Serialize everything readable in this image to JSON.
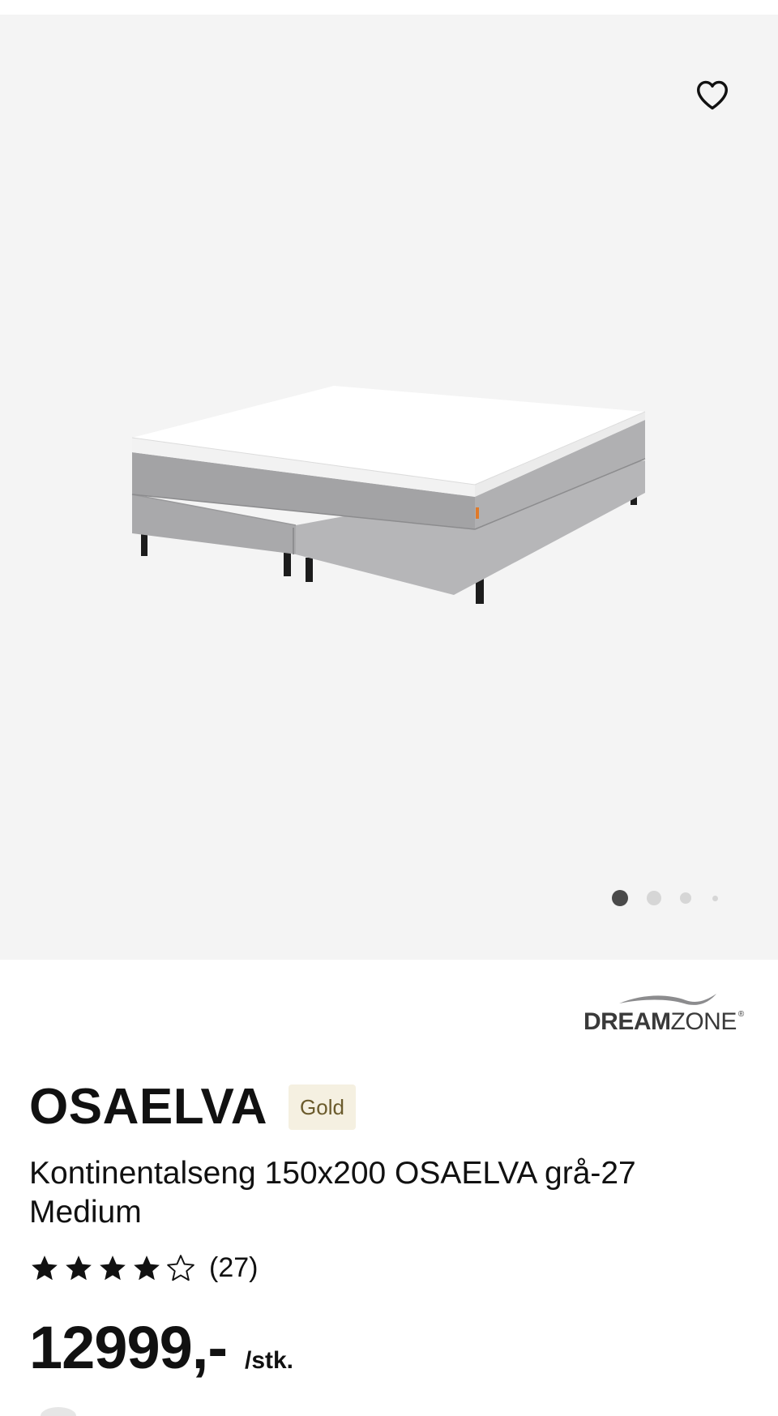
{
  "gallery": {
    "favorite_icon": "heart-outline-icon",
    "image_alt": "Kontinentalseng 150x200 OSAELVA grå-27 Medium",
    "slides": {
      "count": 4,
      "active": 1
    }
  },
  "brand": {
    "name_bold": "DREAM",
    "name_light": "ZONE",
    "registered": "®"
  },
  "product": {
    "name": "OSAELVA",
    "tier_badge": "Gold",
    "subtitle": "Kontinentalseng 150x200 OSAELVA grå-27 Medium"
  },
  "rating": {
    "stars_filled": 4,
    "stars_total": 5,
    "count_label": "(27)"
  },
  "price": {
    "amount": "12999,-",
    "unit": "/stk."
  },
  "colors": {
    "gallery_bg": "#f4f4f4",
    "badge_bg": "#f5f0e1",
    "badge_text": "#6b5b2c",
    "active_dot": "#4a4a4a",
    "inactive_dot": "#d6d6d6"
  }
}
